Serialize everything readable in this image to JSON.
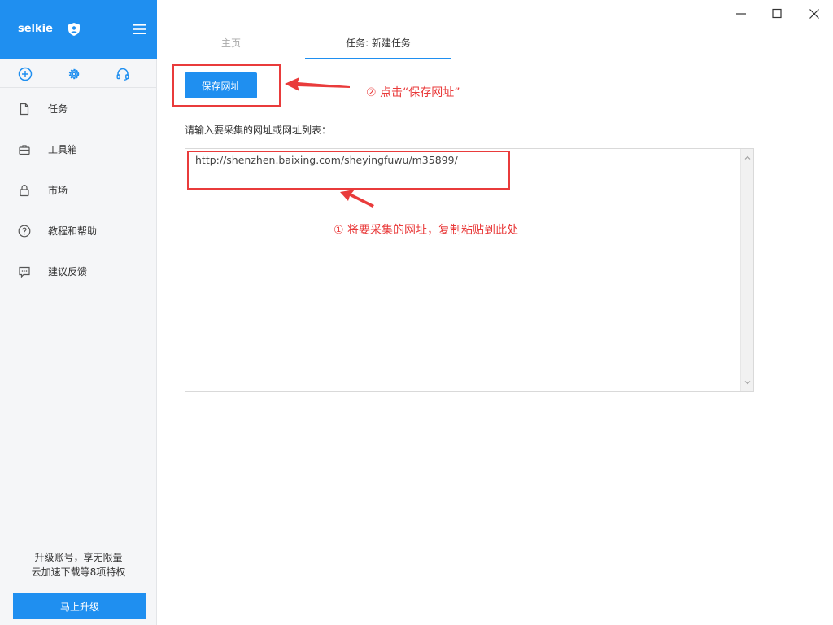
{
  "app": {
    "brand": "selkie"
  },
  "sidebar": {
    "items": [
      {
        "label": "任务",
        "icon": "document-icon"
      },
      {
        "label": "工具箱",
        "icon": "toolbox-icon"
      },
      {
        "label": "市场",
        "icon": "lock-icon"
      },
      {
        "label": "教程和帮助",
        "icon": "help-circle-icon"
      },
      {
        "label": "建议反馈",
        "icon": "chat-icon"
      }
    ],
    "quick_icons": [
      "plus-circle-icon",
      "gear-icon",
      "headset-icon"
    ],
    "promo_line1": "升级账号，享无限量",
    "promo_line2": "云加速下载等8项特权",
    "upgrade_label": "马上升级"
  },
  "tabs": [
    {
      "label": "主页",
      "active": false
    },
    {
      "label": "任务: 新建任务",
      "active": true
    }
  ],
  "main": {
    "save_label": "保存网址",
    "url_prompt": "请输入要采集的网址或网址列表：",
    "url_value": "http://shenzhen.baixing.com/sheyingfuwu/m35899/"
  },
  "annotations": {
    "step1": "① 将要采集的网址，复制粘贴到此处",
    "step2": "② 点击“保存网址”"
  },
  "colors": {
    "accent": "#1f8ff0",
    "annotation": "#e93b3b",
    "sidebar_bg": "#f5f6f8"
  }
}
